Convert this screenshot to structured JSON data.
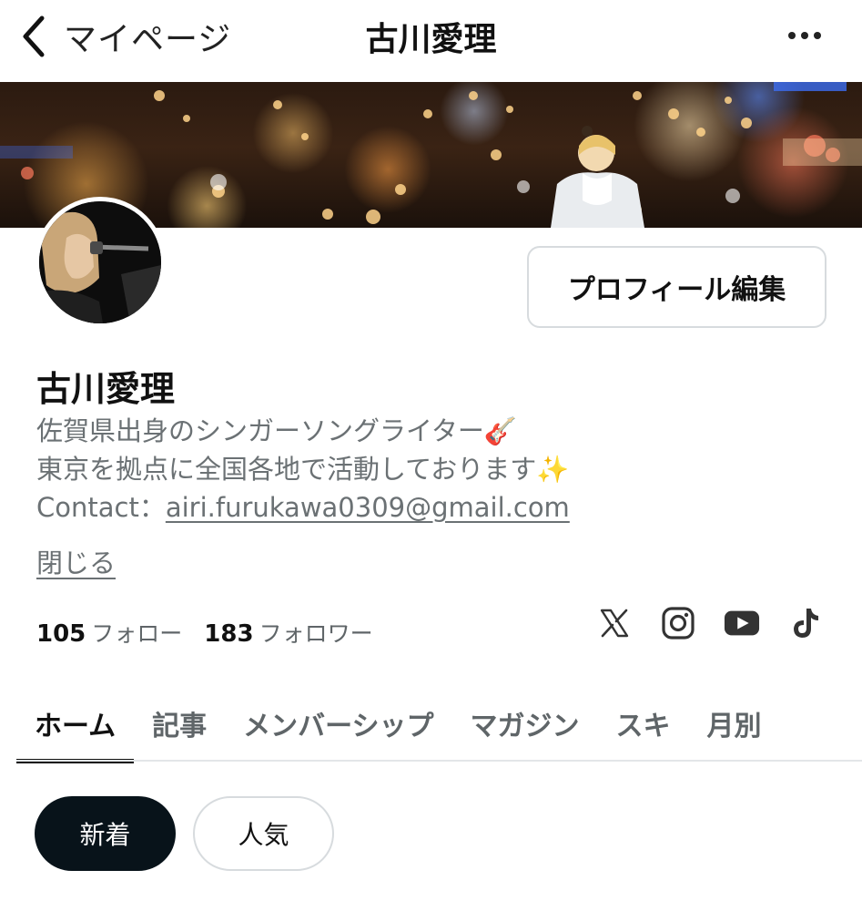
{
  "header": {
    "back_label": "マイページ",
    "title": "古川愛理"
  },
  "profile": {
    "edit_button": "プロフィール編集",
    "name": "古川愛理",
    "bio_line1": "佐賀県出身のシンガーソングライター🎸",
    "bio_line2": "東京を拠点に全国各地で活動しております✨",
    "contact_label": "Contact：",
    "contact_email": "airi.furukawa0309@gmail.com",
    "close_link": "閉じる"
  },
  "stats": {
    "following_count": "105",
    "following_label": "フォロー",
    "followers_count": "183",
    "followers_label": "フォロワー"
  },
  "socials": [
    {
      "icon": "x-icon"
    },
    {
      "icon": "instagram-icon"
    },
    {
      "icon": "youtube-icon"
    },
    {
      "icon": "tiktok-icon"
    }
  ],
  "tabs": [
    {
      "label": "ホーム",
      "active": true
    },
    {
      "label": "記事"
    },
    {
      "label": "メンバーシップ"
    },
    {
      "label": "マガジン"
    },
    {
      "label": "スキ"
    },
    {
      "label": "月別"
    }
  ],
  "filters": {
    "new_label": "新着",
    "popular_label": "人気"
  },
  "colors": {
    "text_primary": "#08131a",
    "text_secondary": "#6b7174",
    "border": "#d7dbde",
    "pill_active_bg": "#08131a"
  }
}
